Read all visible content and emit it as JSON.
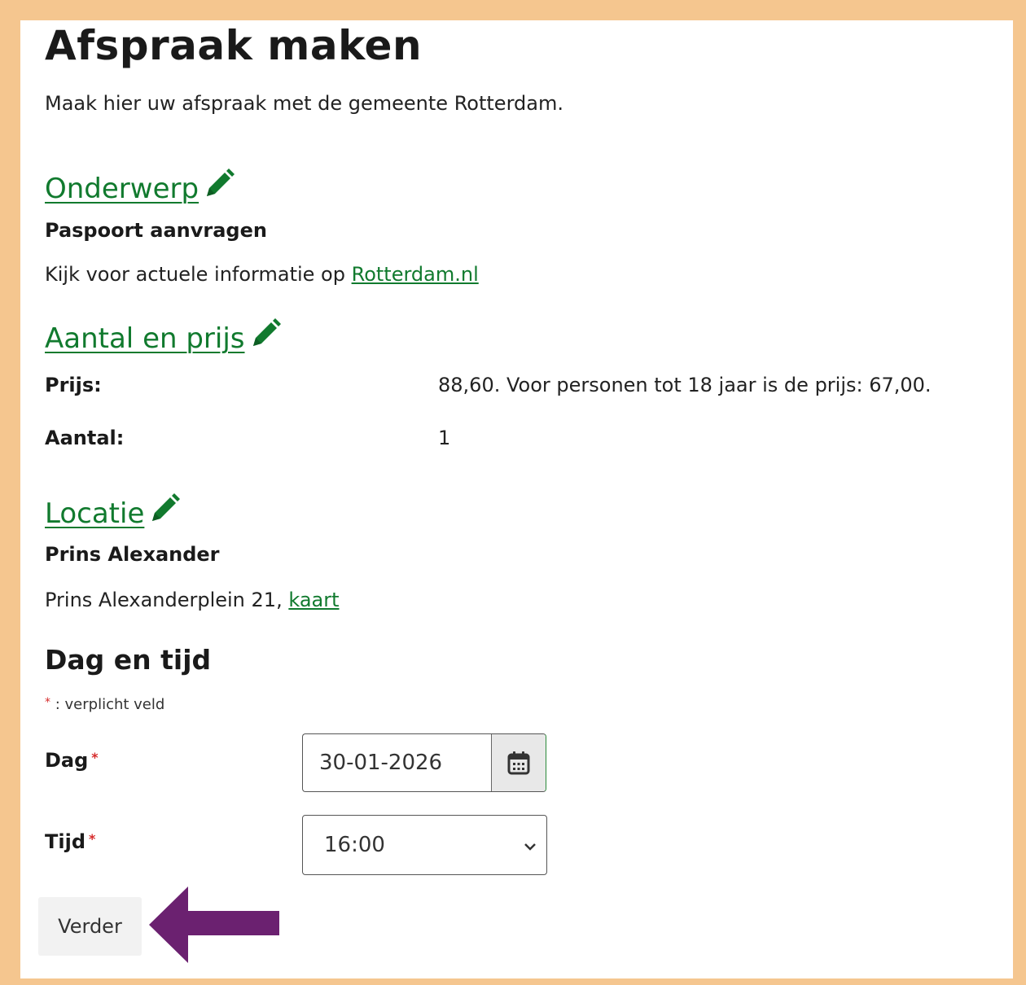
{
  "page": {
    "title": "Afspraak maken",
    "intro": "Maak hier uw afspraak met de gemeente Rotterdam."
  },
  "onderwerp": {
    "heading": "Onderwerp",
    "value": "Paspoort aanvragen",
    "info_prefix": "Kijk voor actuele informatie op ",
    "info_link": "Rotterdam.nl"
  },
  "aantal_prijs": {
    "heading": "Aantal en prijs",
    "price_label": "Prijs:",
    "price_value": "88,60. Voor personen tot 18 jaar is de prijs: 67,00.",
    "count_label": "Aantal:",
    "count_value": "1"
  },
  "locatie": {
    "heading": "Locatie",
    "name": "Prins Alexander",
    "address": "Prins Alexanderplein 21,",
    "map_link": "kaart"
  },
  "dag_tijd": {
    "heading": "Dag en tijd",
    "required_note": ": verplicht veld",
    "required_marker": "*",
    "dag_label": "Dag",
    "dag_value": "30-01-2026",
    "tijd_label": "Tijd",
    "tijd_value": "16:00"
  },
  "actions": {
    "next_label": "Verder"
  },
  "colors": {
    "link_green": "#117a2e",
    "frame_orange": "#f5c68f",
    "arrow_purple": "#6b2170",
    "required_red": "#d62b2b"
  },
  "icons": {
    "edit": "pencil-icon",
    "calendar": "calendar-icon",
    "dropdown": "chevron-down-icon",
    "pointer": "arrow-left-icon"
  }
}
